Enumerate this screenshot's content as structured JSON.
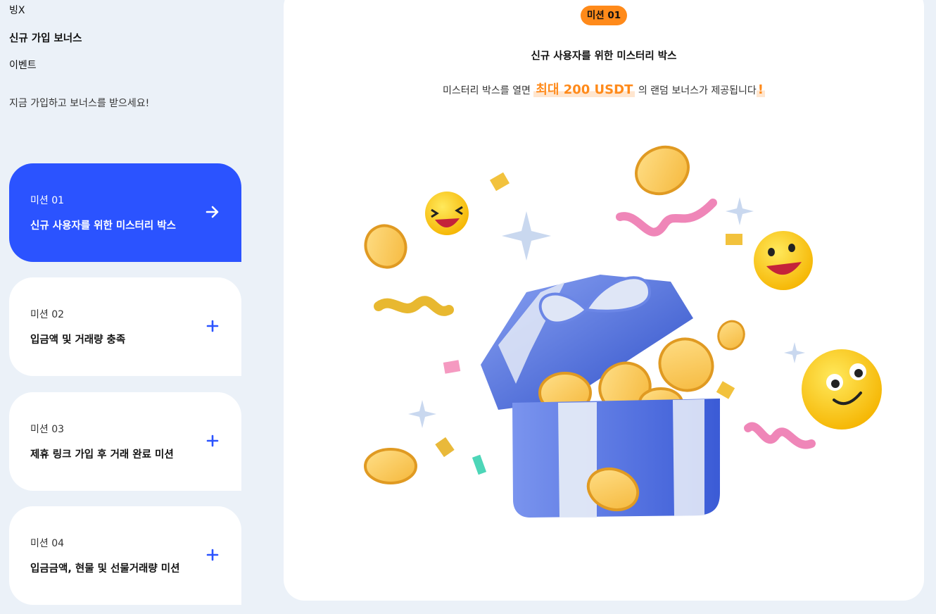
{
  "breadcrumb": {
    "brand": "빙X",
    "title": "신규 가입 보너스",
    "section": "이벤트"
  },
  "tagline": "지금 가입하고 보너스를 받으세요!",
  "missions": [
    {
      "num": "미션 01",
      "name": "신규 사용자를 위한 미스터리 박스",
      "action_icon": "arrow-right-icon",
      "active": true
    },
    {
      "num": "미션 02",
      "name": "입금액 및 거래량 충족",
      "action_icon": "plus-icon",
      "active": false
    },
    {
      "num": "미션 03",
      "name": "제휴 링크 가입 후 거래 완료 미션",
      "action_icon": "plus-icon",
      "active": false
    },
    {
      "num": "미션 04",
      "name": "입금금액, 현물 및 선물거래량 미션",
      "action_icon": "plus-icon",
      "active": false
    }
  ],
  "detail": {
    "badge": "미션 01",
    "title": "신규 사용자를 위한 미스터리 박스",
    "desc_before": "미스터리 박스를 열면",
    "desc_highlight": "최대 200 USDT",
    "desc_after": "의 랜덤 보너스가 제공됩니다",
    "desc_exclaim": "!"
  },
  "colors": {
    "accent_blue": "#2b53ff",
    "accent_orange": "#ff8a1a",
    "background": "#ebf1f8"
  }
}
